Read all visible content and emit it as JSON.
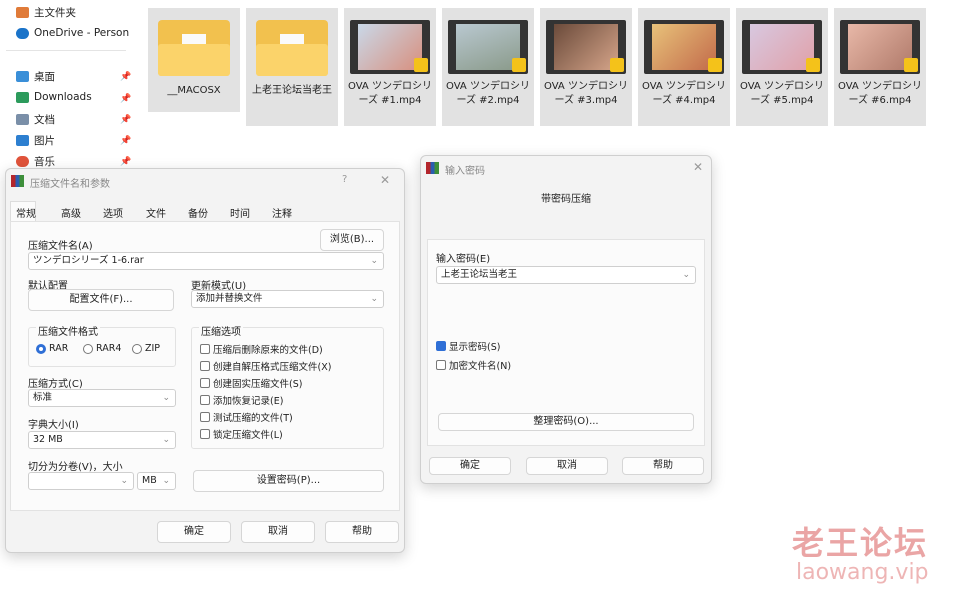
{
  "sidebar": {
    "items": [
      {
        "label": "主文件夹",
        "icon": "home-icon",
        "color": "#e07b39"
      },
      {
        "label": "OneDrive - Person",
        "icon": "cloud-icon",
        "color": "#1a73c9"
      },
      {
        "label": "桌面",
        "icon": "desktop-icon",
        "color": "#3a8fd8",
        "pinned": true
      },
      {
        "label": "Downloads",
        "icon": "download-icon",
        "color": "#2c9b5c",
        "pinned": true
      },
      {
        "label": "文档",
        "icon": "document-icon",
        "color": "#7a8fa8",
        "pinned": true
      },
      {
        "label": "图片",
        "icon": "pictures-icon",
        "color": "#2d7fd0",
        "pinned": true
      },
      {
        "label": "音乐",
        "icon": "music-icon",
        "color": "#e0533a",
        "pinned": true
      }
    ]
  },
  "files": [
    {
      "name": "__MACOSX",
      "type": "folder"
    },
    {
      "name": "上老王论坛当老王",
      "type": "folder"
    },
    {
      "name": "OVA ツンデロシリーズ #1.mp4",
      "type": "video"
    },
    {
      "name": "OVA ツンデロシリーズ #2.mp4",
      "type": "video"
    },
    {
      "name": "OVA ツンデロシリーズ #3.mp4",
      "type": "video"
    },
    {
      "name": "OVA ツンデロシリーズ #4.mp4",
      "type": "video"
    },
    {
      "name": "OVA ツンデロシリーズ #5.mp4",
      "type": "video"
    },
    {
      "name": "OVA ツンデロシリーズ #6.mp4",
      "type": "video"
    }
  ],
  "archive_dialog": {
    "title": "压缩文件名和参数",
    "help": "?",
    "close": "✕",
    "tabs": [
      "常规",
      "高级",
      "选项",
      "文件",
      "备份",
      "时间",
      "注释"
    ],
    "archive_name_label": "压缩文件名(A)",
    "browse": "浏览(B)...",
    "archive_name": "ツンデロシリーズ 1-6.rar",
    "profile_label": "默认配置",
    "profile_button": "配置文件(F)...",
    "update_mode_label": "更新模式(U)",
    "update_mode": "添加并替换文件",
    "format_label": "压缩文件格式",
    "formats": [
      "RAR",
      "RAR4",
      "ZIP"
    ],
    "format_selected": "RAR",
    "method_label": "压缩方式(C)",
    "method": "标准",
    "dict_label": "字典大小(I)",
    "dict": "32 MB",
    "split_label": "切分为分卷(V)，大小",
    "split_value": "",
    "split_unit": "MB",
    "options_label": "压缩选项",
    "options": [
      "压缩后删除原来的文件(D)",
      "创建自解压格式压缩文件(X)",
      "创建固实压缩文件(S)",
      "添加恢复记录(E)",
      "测试压缩的文件(T)",
      "锁定压缩文件(L)"
    ],
    "set_password": "设置密码(P)...",
    "ok": "确定",
    "cancel": "取消",
    "help_button": "帮助"
  },
  "password_dialog": {
    "title": "输入密码",
    "close": "✕",
    "heading": "带密码压缩",
    "password_label": "输入密码(E)",
    "password": "上老王论坛当老王",
    "show_password": "显示密码(S)",
    "show_password_checked": true,
    "encrypt_names": "加密文件名(N)",
    "encrypt_names_checked": false,
    "organize": "整理密码(O)...",
    "ok": "确定",
    "cancel": "取消",
    "help_button": "帮助"
  },
  "watermark": {
    "cn": "老王论坛",
    "url": "laowang.vip",
    "color": "#e8a0a0"
  }
}
